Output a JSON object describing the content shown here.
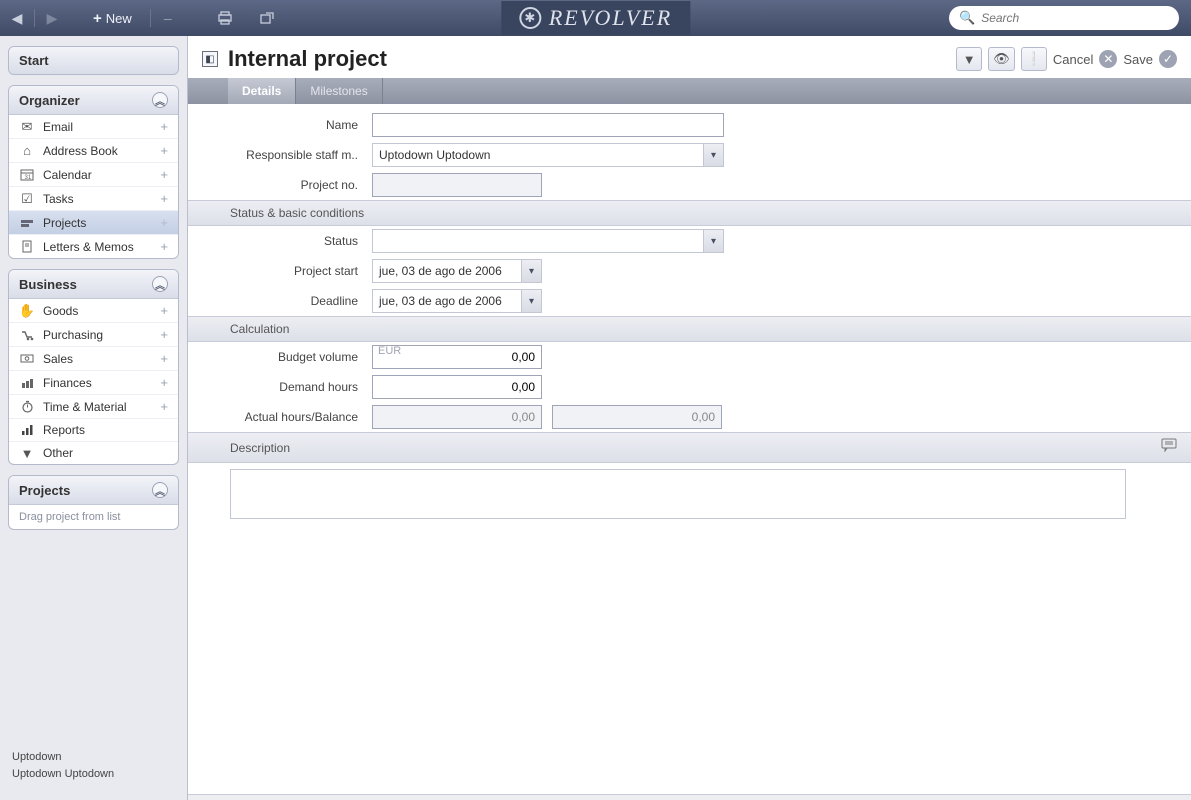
{
  "topbar": {
    "new_label": "New",
    "search_placeholder": "Search"
  },
  "brand": {
    "name": "revolver"
  },
  "sidebar": {
    "start_label": "Start",
    "organizer": {
      "title": "Organizer",
      "items": [
        {
          "label": "Email"
        },
        {
          "label": "Address Book"
        },
        {
          "label": "Calendar"
        },
        {
          "label": "Tasks"
        },
        {
          "label": "Projects",
          "active": true
        },
        {
          "label": "Letters & Memos"
        }
      ]
    },
    "business": {
      "title": "Business",
      "items": [
        {
          "label": "Goods"
        },
        {
          "label": "Purchasing"
        },
        {
          "label": "Sales"
        },
        {
          "label": "Finances"
        },
        {
          "label": "Time & Material"
        },
        {
          "label": "Reports"
        },
        {
          "label": "Other"
        }
      ]
    },
    "projects": {
      "title": "Projects",
      "placeholder": "Drag project from list"
    }
  },
  "footer": {
    "line1": "Uptodown",
    "line2": "Uptodown Uptodown"
  },
  "page": {
    "title": "Internal project",
    "tabs": {
      "details": "Details",
      "milestones": "Milestones"
    },
    "actions": {
      "cancel": "Cancel",
      "save": "Save"
    },
    "labels": {
      "name": "Name",
      "responsible": "Responsible staff m..",
      "project_no": "Project no.",
      "status_section": "Status & basic conditions",
      "status": "Status",
      "project_start": "Project start",
      "deadline": "Deadline",
      "calc_section": "Calculation",
      "budget": "Budget volume",
      "demand": "Demand hours",
      "actual": "Actual hours/Balance",
      "desc_section": "Description"
    },
    "values": {
      "name": "",
      "responsible": "Uptodown Uptodown",
      "project_no": "",
      "status": "",
      "project_start": "jue, 03 de ago de 2006",
      "deadline": "jue, 03 de ago de 2006",
      "budget_currency": "EUR",
      "budget": "0,00",
      "demand": "0,00",
      "actual": "0,00",
      "balance": "0,00",
      "description": ""
    }
  }
}
